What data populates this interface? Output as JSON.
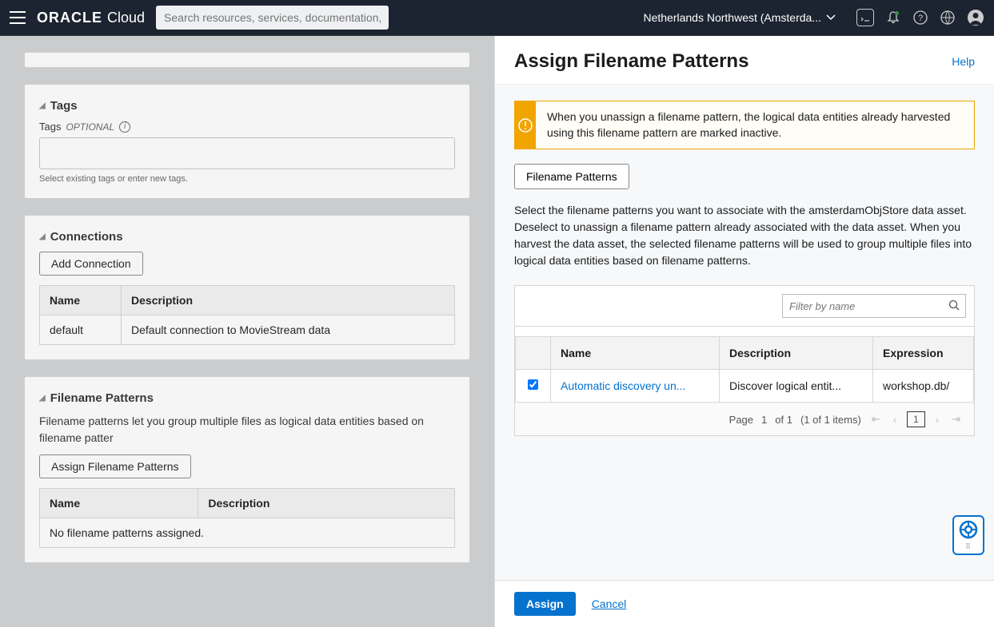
{
  "topbar": {
    "logo_bold": "ORACLE",
    "logo_light": "Cloud",
    "search_placeholder": "Search resources, services, documentation, and marketplace",
    "region": "Netherlands Northwest (Amsterda..."
  },
  "tags": {
    "section_title": "Tags",
    "label": "Tags",
    "optional": "OPTIONAL",
    "hint": "Select existing tags or enter new tags."
  },
  "connections": {
    "title": "Connections",
    "add_btn": "Add Connection",
    "cols": {
      "name": "Name",
      "desc": "Description"
    },
    "rows": [
      {
        "name": "default",
        "desc": "Default connection to MovieStream data"
      }
    ]
  },
  "patterns": {
    "title": "Filename Patterns",
    "desc": "Filename patterns let you group multiple files as logical data entities based on filename patter",
    "assign_btn": "Assign Filename Patterns",
    "cols": {
      "name": "Name",
      "desc": "Description"
    },
    "empty": "No filename patterns assigned."
  },
  "panel": {
    "title": "Assign Filename Patterns",
    "help": "Help",
    "alert": "When you unassign a filename pattern, the logical data entities already harvested using this filename pattern are marked inactive.",
    "fp_btn": "Filename Patterns",
    "description": "Select the filename patterns you want to associate with the amsterdamObjStore data asset. Deselect to unassign a filename pattern already associated with the data asset. When you harvest the data asset, the selected filename patterns will be used to group multiple files into logical data entities based on filename patterns.",
    "filter_placeholder": "Filter by name",
    "cols": {
      "name": "Name",
      "desc": "Description",
      "expr": "Expression"
    },
    "rows": [
      {
        "checked": true,
        "name": "Automatic discovery un...",
        "desc": "Discover logical entit...",
        "expr": "workshop.db/"
      }
    ],
    "pager": {
      "page_label": "Page",
      "current": "1",
      "of": "of 1",
      "items": "(1 of 1 items)"
    },
    "assign": "Assign",
    "cancel": "Cancel"
  }
}
